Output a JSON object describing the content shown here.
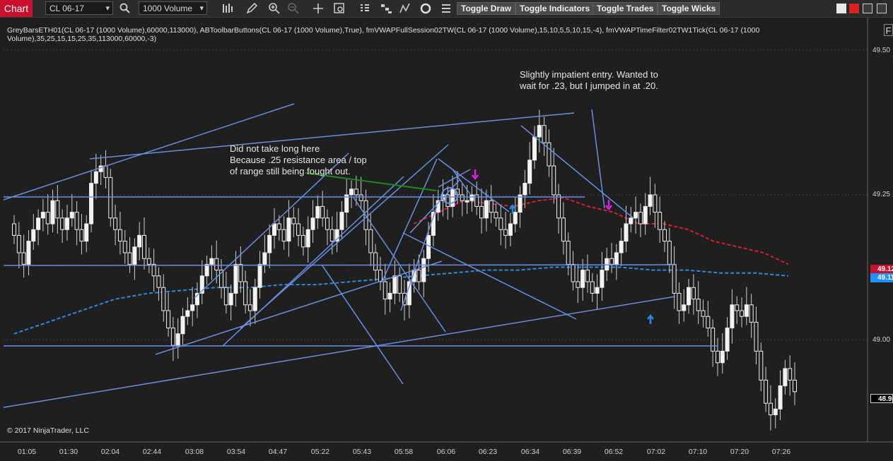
{
  "toolbar": {
    "chart_tab": "Chart",
    "instrument": "CL 06-17",
    "period": "1000 Volume",
    "buttons": [
      "Toggle Draw",
      "Toggle Indicators",
      "Toggle Trades",
      "Toggle Wicks"
    ]
  },
  "indicator_line": "GreyBarsETH01(CL 06-17 (1000 Volume),60000,113000), ABToolbarButtons(CL 06-17 (1000 Volume),True), fmVWAPFullSession02TW(CL 06-17 (1000 Volume),15,10,5,5,10,15,-4), fmVWAPTimeFilter02TW1Tick(CL 06-17 (1000 Volume),35,25,15,15,25,35,113000,60000,-3)",
  "corner_button": "F",
  "annotations": [
    {
      "lines": [
        "Slightly impatient entry. Wanted to",
        "wait for .23, but I jumped in at .20."
      ]
    },
    {
      "lines": [
        "Did not take long here",
        "Because .25 resistance area / top",
        "of range still being fought out."
      ]
    }
  ],
  "price_axis": [
    "49.50",
    "49.25",
    "49.00"
  ],
  "price_tags": [
    {
      "label": "49.12",
      "color": "#c8102e"
    },
    {
      "label": "49.11",
      "color": "#1e90ff"
    },
    {
      "label": "48.90",
      "color": "#000000"
    }
  ],
  "time_axis": [
    "01:05",
    "01:30",
    "02:04",
    "02:44",
    "03:08",
    "03:54",
    "04:47",
    "05:22",
    "05:43",
    "05:58",
    "06:06",
    "06:23",
    "06:34",
    "06:39",
    "06:52",
    "07:02",
    "07:10",
    "07:20",
    "07:26"
  ],
  "copyright": "© 2017 NinjaTrader, LLC",
  "colors": {
    "background": "#1f1f1f",
    "draw_lines": "#6a8fe0",
    "vwap_red": "#d4203a",
    "vwap_blue": "#2a8ae0",
    "entry_arrow": "#1a8a1a",
    "sell_arrow": "#e020e0",
    "buy_arrow": "#2a8ae0"
  },
  "chart_data": {
    "type": "candlestick",
    "ylim": [
      48.82,
      49.52
    ],
    "close_series": [
      49.18,
      49.15,
      49.13,
      49.17,
      49.19,
      49.21,
      49.22,
      49.2,
      49.24,
      49.21,
      49.19,
      49.21,
      49.22,
      49.19,
      49.17,
      49.2,
      49.27,
      49.29,
      49.3,
      49.28,
      49.21,
      49.19,
      49.17,
      49.15,
      49.13,
      49.16,
      49.18,
      49.14,
      49.13,
      49.11,
      49.09,
      49.05,
      49.02,
      48.99,
      49.01,
      49.04,
      49.05,
      49.06,
      49.08,
      49.11,
      49.13,
      49.14,
      49.12,
      49.09,
      49.06,
      49.08,
      49.13,
      49.1,
      49.06,
      49.05,
      49.09,
      49.13,
      49.15,
      49.18,
      49.2,
      49.19,
      49.17,
      49.21,
      49.2,
      49.18,
      49.16,
      49.19,
      49.21,
      49.23,
      49.21,
      49.19,
      49.17,
      49.19,
      49.22,
      49.25,
      49.26,
      49.25,
      49.24,
      49.19,
      49.15,
      49.12,
      49.1,
      49.07,
      49.08,
      49.11,
      49.08,
      49.06,
      49.1,
      49.12,
      49.1,
      49.14,
      49.18,
      49.22,
      49.24,
      49.25,
      49.23,
      49.26,
      49.25,
      49.24,
      49.24,
      49.25,
      49.23,
      49.21,
      49.24,
      49.22,
      49.21,
      49.19,
      49.18,
      49.2,
      49.22,
      49.25,
      49.27,
      49.31,
      49.35,
      49.37,
      49.34,
      49.3,
      49.25,
      49.21,
      49.17,
      49.13,
      49.1,
      49.09,
      49.12,
      49.1,
      49.08,
      49.09,
      49.12,
      49.14,
      49.13,
      49.15,
      49.17,
      49.2,
      49.21,
      49.22,
      49.2,
      49.23,
      49.25,
      49.22,
      49.19,
      49.17,
      49.13,
      49.08,
      49.05,
      49.06,
      49.09,
      49.07,
      49.05,
      49.04,
      49.02,
      48.98,
      48.96,
      48.98,
      49.02,
      49.06,
      49.05,
      49.04,
      49.06,
      49.03,
      48.98,
      48.93,
      48.89,
      48.87,
      48.88,
      48.92,
      48.95,
      48.93,
      48.91
    ]
  }
}
